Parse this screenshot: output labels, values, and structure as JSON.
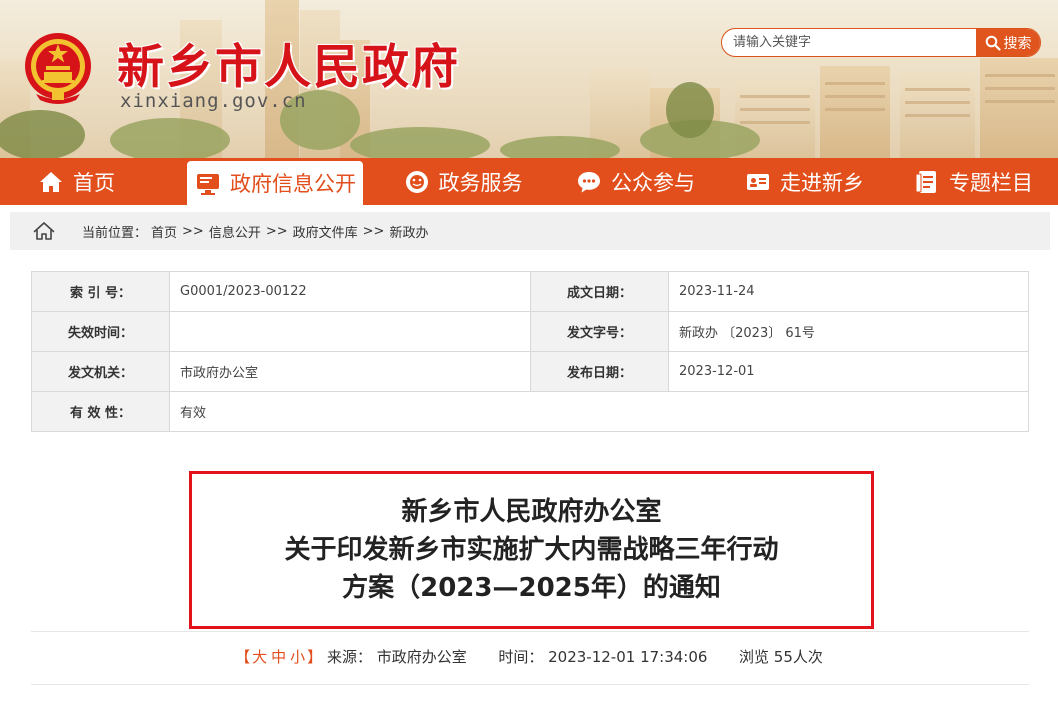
{
  "header": {
    "site_title": "新乡市人民政府",
    "site_domain": "xinxiang.gov.cn",
    "search_placeholder": "请输入关键字",
    "search_button": "搜索"
  },
  "nav": {
    "items": [
      {
        "label": "首页",
        "icon": "home-icon"
      },
      {
        "label": "政府信息公开",
        "icon": "monitor-icon",
        "active": true
      },
      {
        "label": "政务服务",
        "icon": "service-icon"
      },
      {
        "label": "公众参与",
        "icon": "chat-icon"
      },
      {
        "label": "走进新乡",
        "icon": "card-icon"
      },
      {
        "label": "专题栏目",
        "icon": "document-icon"
      }
    ]
  },
  "breadcrumb": {
    "label": "当前位置：",
    "items": [
      "首页",
      "信息公开",
      "政府文件库",
      "新政办"
    ],
    "separator": ">>"
  },
  "info": {
    "index_label": "索 引 号：",
    "index_value": "G0001/2023-00122",
    "date_label": "成文日期：",
    "date_value": "2023-11-24",
    "expiry_label": "失效时间：",
    "expiry_value": "",
    "docno_label": "发文字号：",
    "docno_value": "新政办 〔2023〕 61号",
    "issuer_label": "发文机关：",
    "issuer_value": "市政府办公室",
    "publish_label": "发布日期：",
    "publish_value": "2023-12-01",
    "validity_label": "有 效 性：",
    "validity_value": "有效"
  },
  "document": {
    "title_lines": [
      "新乡市人民政府办公室",
      "关于印发新乡市实施扩大内需战略三年行动",
      "方案（2023—2025年）的通知"
    ]
  },
  "meta": {
    "font_open": "【",
    "font_large": "大",
    "font_medium": "中",
    "font_small": "小",
    "font_close": "】",
    "source_label": "来源：",
    "source_value": "市政府办公室",
    "time_label": "时间：",
    "time_value": "2023-12-01 17:34:06",
    "views_prefix": "浏览",
    "views_count": "55",
    "views_suffix": "人次"
  },
  "colors": {
    "brand_red": "#d7131a",
    "nav_orange": "#e24f1c",
    "title_border": "#e3131b"
  }
}
